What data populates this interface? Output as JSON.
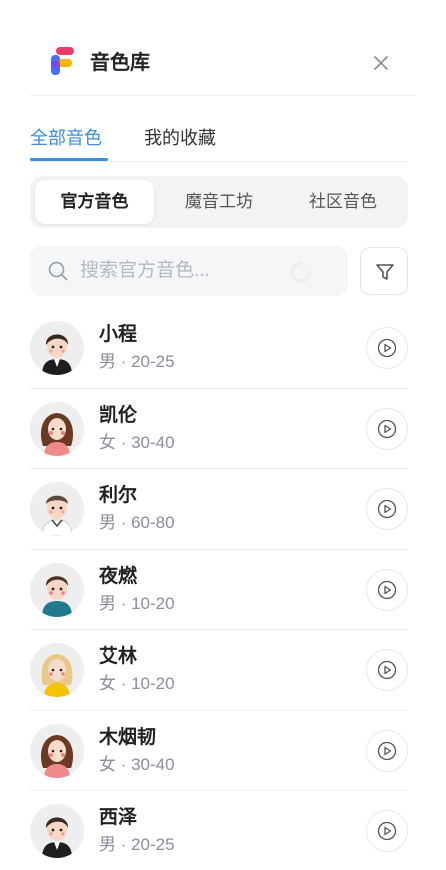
{
  "header": {
    "title": "音色库",
    "logo_icon": "app-logo-icon",
    "close_icon": "close-icon"
  },
  "tabs": [
    {
      "label": "全部音色",
      "active": true
    },
    {
      "label": "我的收藏",
      "active": false
    }
  ],
  "segments": [
    {
      "label": "官方音色",
      "active": true
    },
    {
      "label": "魔音工坊",
      "active": false
    },
    {
      "label": "社区音色",
      "active": false
    }
  ],
  "search": {
    "placeholder": "搜索官方音色...",
    "value": ""
  },
  "filter_icon": "filter-icon",
  "voices": [
    {
      "name": "小程",
      "meta": "男 · 20-25",
      "avatar": "male-dark-hair-black-suit"
    },
    {
      "name": "凯伦",
      "meta": "女 · 30-40",
      "avatar": "female-long-hair-pink"
    },
    {
      "name": "利尔",
      "meta": "男 · 60-80",
      "avatar": "male-grey-hair-white-shirt"
    },
    {
      "name": "夜燃",
      "meta": "男 · 10-20",
      "avatar": "male-teal-shirt"
    },
    {
      "name": "艾林",
      "meta": "女 · 10-20",
      "avatar": "female-blonde-yellow"
    },
    {
      "name": "木烟韧",
      "meta": "女 · 30-40",
      "avatar": "female-long-hair-pink"
    },
    {
      "name": "西泽",
      "meta": "男 · 20-25",
      "avatar": "male-dark-hair-black-suit"
    }
  ],
  "colors": {
    "accent": "#3a8ee6",
    "text": "#222222",
    "muted": "#8a8f99"
  }
}
